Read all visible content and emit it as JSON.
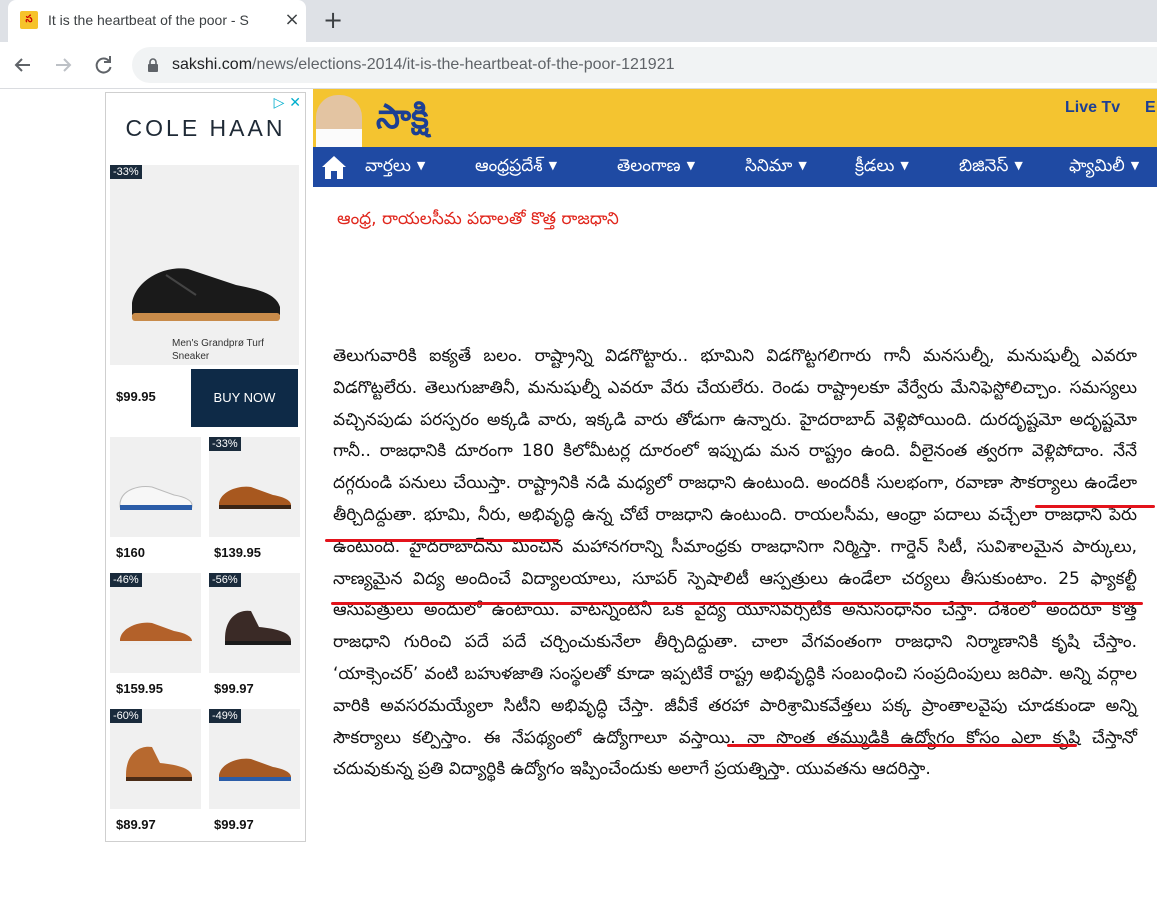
{
  "browser": {
    "tab_title": "It is the heartbeat of the poor - S",
    "url_host": "sakshi.com",
    "url_path": "/news/elections-2014/it-is-the-heartbeat-of-the-poor-121921"
  },
  "ad": {
    "brand": "COLE HAAN",
    "ad_choice": "▷ ✕",
    "featured": {
      "discount": "-33%",
      "name": "Men's Grandprø Turf Sneaker",
      "price": "$99.95",
      "cta": "BUY NOW"
    },
    "products": [
      {
        "discount": "",
        "price": "$160"
      },
      {
        "discount": "-33%",
        "price": "$139.95"
      },
      {
        "discount": "-46%",
        "price": "$159.95"
      },
      {
        "discount": "-56%",
        "price": "$99.97"
      },
      {
        "discount": "-60%",
        "price": "$89.97"
      },
      {
        "discount": "-49%",
        "price": "$99.97"
      }
    ]
  },
  "site": {
    "logo": "సాక్షి",
    "live_tv": "Live Tv",
    "e_link": "E",
    "menu": [
      "వార్తలు",
      "ఆంధ్రప్రదేశ్",
      "తెలంగాణ",
      "సినిమా",
      "క్రీడలు",
      "బిజినెస్",
      "ఫ్యామిలీ"
    ]
  },
  "article": {
    "related_link": "ఆంధ్ర, రాయలసీమ పదాలతో కొత్త రాజధాని",
    "body": "తెలుగువారికి ఐక్యతే బలం. రాష్ట్రాన్ని విడగొట్టారు.. భూమిని విడగొట్టగలిగారు గానీ మనసుల్నీ, మనుషుల్నీ ఎవరూ విడగొట్టలేరు. తెలుగుజాతినీ, మనుషుల్నీ ఎవరూ వేరు చేయలేరు. రెండు రాష్ట్రాలకూ వేర్వేరు మేనిఫెస్టోలిచ్చాం. సమస్యలు వచ్చినపుడు పరస్పరం అక్కడి వారు, ఇక్కడి వారు తోడుగా ఉన్నారు. హైదరాబాద్ వెళ్లిపోయింది. దురదృష్టమో అదృష్టమో గానీ.. రాజధానికి దూరంగా 180 కిలోమీటర్ల దూరంలో ఇప్పుడు మన రాష్ట్రం ఉంది. వీలైనంత త్వరగా వెళ్లిపోదాం. నేనే దగ్గరుండి పనులు చేయిస్తా. రాష్ట్రానికి నడి మధ్యలో రాజధాని ఉంటుంది. అందరికీ సులభంగా, రవాణా సౌకర్యాలు ఉండేలా తీర్చిదిద్దుతా. భూమి, నీరు, అభివృద్ధి ఉన్న చోటే రాజధాని ఉంటుంది. రాయలసీమ, ఆంధ్రా పదాలు వచ్చేలా రాజధాని పేరు ఉంటుంది. హైదరాబాద్‌ను మించిన మహానగరాన్ని సీమాంధ్రకు రాజధానిగా నిర్మిస్తా. గార్డెన్ సిటీ, సువిశాలమైన పార్కులు, నాణ్యమైన విద్య అందించే విద్యాలయాలు, సూపర్ స్పెషాలిటీ ఆస్పత్రులు ఉండేలా చర్యలు తీసుకుంటాం. 25 ఫ్యాకల్టీ ఆసుపత్రులు అందులో ఉంటాయి. వాటన్నింటినీ ఒక వైద్య యూనివర్సిటీకి అనుసంధానం చేస్తా. దేశంలో అందరూ కొత్త రాజధాని గురించి పదే పదే చర్చించుకునేలా తీర్చిదిద్దుతా. చాలా వేగవంతంగా రాజధాని నిర్మాణానికి కృషి చేస్తాం. ‘యాక్సెంచర్’ వంటి బహుళజాతి సంస్థలతో కూడా ఇప్పటికే రాష్ట్ర అభివృద్ధికి సంబంధించి సంప్రదింపులు జరిపా. అన్ని వర్గాల వారికి అవసరమయ్యేలా సిటీని అభివృద్ధి చేస్తా. జీవీకే తరహా పారిశ్రామికవేత్తలు పక్క ప్రాంతాలవైపు చూడకుండా అన్ని సౌకర్యాలు కల్పిస్తాం. ఈ నేపథ్యంలో ఉద్యోగాలూ వస్తాయి. నా సొంత తమ్ముడికి ఉద్యోగం కోసం ఎలా కృషి చేస్తానో చదువుకున్న ప్రతి విద్యార్థికి ఉద్యోగం ఇప్పించేందుకు అలాగే ప్రయత్నిస్తా. యువతను ఆదరిస్తా."
  }
}
